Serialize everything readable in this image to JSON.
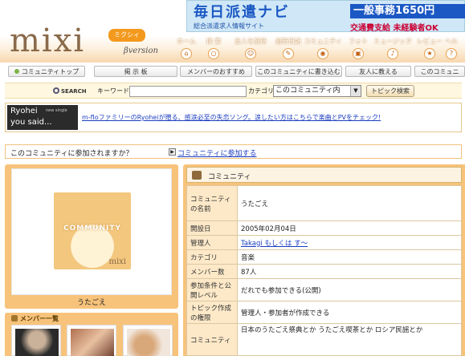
{
  "header": {
    "logo": "mixi",
    "logo_kana": "ミクシィ",
    "logo_beta": "βversion",
    "ad": {
      "title": "毎日派遣ナビ",
      "subtitle": "総合派遣求人情報サイト",
      "price": "一般事務1650円",
      "ok": "交通費支給 未経験者OK"
    },
    "nav": [
      "ホーム",
      "検 索",
      "友人を招待",
      "最新日記",
      "コミュニティ",
      "フォト",
      "ミュージック",
      "レビュー",
      "ヘル"
    ]
  },
  "menubar": [
    "コミュニティトップ",
    "掲 示 板",
    "メンバーのおすすめ",
    "このコミュニティに書き込む",
    "友人に教える",
    "このコミュニ"
  ],
  "search": {
    "badge": "SEARCH",
    "keyword_label": "キーワード",
    "keyword_value": "",
    "category_label": "カテゴリ",
    "category_value": "このコミュニティ内",
    "button": "トピック検索"
  },
  "banner": {
    "img_name": "Ryohei",
    "img_said": "you said...",
    "img_note": "new single",
    "link": "m-floファミリーのRyoheiが贈る、感涙必至の失恋ソング。涙したい方はこちらで楽曲とPVをチェック!"
  },
  "join": {
    "question": "このコミュニティに参加されますか？",
    "link": "コミュニティに参加する"
  },
  "left": {
    "image_text": "COMMUNITY",
    "image_brand": "mixi",
    "name": "うたごえ",
    "members_title": "メンバー一覧"
  },
  "right": {
    "header": "コミュニティ",
    "rows": [
      {
        "key": "コミュニティの名前",
        "value": "うたごえ",
        "link": false
      },
      {
        "key": "開設日",
        "value": "2005年02月04日",
        "link": false
      },
      {
        "key": "管理人",
        "value": "Takagi もしくは す〜",
        "link": true
      },
      {
        "key": "カテゴリ",
        "value": "音楽",
        "link": false
      },
      {
        "key": "メンバー数",
        "value": "87人",
        "link": false
      },
      {
        "key": "参加条件と公開レベル",
        "value": "だれでも参加できる(公開)",
        "link": false
      },
      {
        "key": "トピック作成の権限",
        "value": "管理人・参加者が作成できる",
        "link": false
      },
      {
        "key": "コミュニティ",
        "value": "日本のうたごえ祭典とか うたごえ喫茶とか ロシア民謡とか",
        "link": false
      }
    ]
  }
}
